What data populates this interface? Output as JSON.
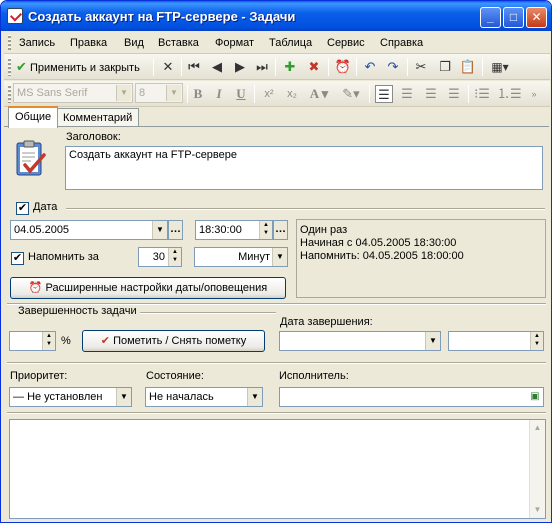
{
  "window": {
    "title": "Создать аккаунт на FTP-сервере - Задачи"
  },
  "menu": [
    "Запись",
    "Правка",
    "Вид",
    "Вставка",
    "Формат",
    "Таблица",
    "Сервис",
    "Справка"
  ],
  "toolbar": {
    "apply_close": "Применить и закрыть"
  },
  "format_bar": {
    "font": "MS Sans Serif",
    "size": "8"
  },
  "tabs": {
    "general": "Общие",
    "comment": "Комментарий"
  },
  "general": {
    "subject_label": "Заголовок:",
    "subject_value": "Создать аккаунт на FTP-сервере",
    "date_label": "Дата",
    "date_value": "04.05.2005",
    "time_value": "18:30:00",
    "remind_label": "Напомнить за",
    "remind_value": "30",
    "remind_unit": "Минут",
    "recurrence_info": {
      "line1": "Один раз",
      "line2": "Начиная с 04.05.2005 18:30:00",
      "line3": "Напомнить: 04.05.2005 18:00:00"
    },
    "advanced_button": "Расширенные настройки даты/оповещения",
    "completion_label": "Завершенность задачи",
    "percent_sign": "%",
    "mark_button": "Пометить / Снять пометку",
    "completion_date_label": "Дата завершения:",
    "priority_label": "Приоритет:",
    "priority_value": "Не установлен",
    "status_label": "Состояние:",
    "status_value": "Не началась",
    "assignee_label": "Исполнитель:"
  },
  "colors": {
    "accent": "#0A5FE8",
    "check": "#C0392B"
  }
}
